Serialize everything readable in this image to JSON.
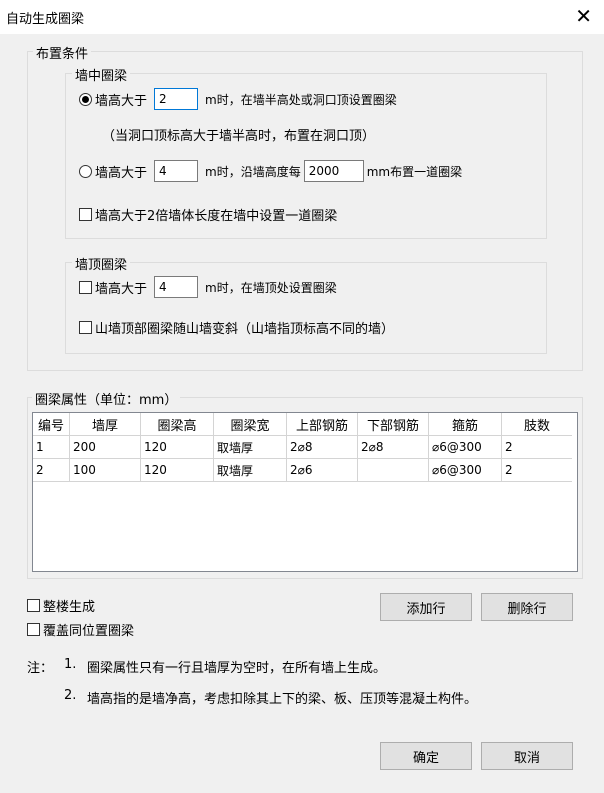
{
  "window": {
    "title": "自动生成圈梁",
    "close_glyph": "✕"
  },
  "layout_group": {
    "label": "布置条件",
    "wall_middle": {
      "label": "墙中圈梁",
      "option1": {
        "prefix": "墙高大于",
        "value": "2",
        "suffix": "m时，在墙半高处或洞口顶设置圈梁",
        "note": "（当洞口顶标高大于墙半高时，布置在洞口顶）",
        "selected": true
      },
      "option2": {
        "prefix": "墙高大于",
        "value": "4",
        "mid": "m时，沿墙高度每",
        "value2": "2000",
        "suffix": "mm布置一道圈梁",
        "selected": false
      },
      "check1": {
        "label": "墙高大于2倍墙体长度在墙中设置一道圈梁",
        "checked": false
      }
    },
    "wall_top": {
      "label": "墙顶圈梁",
      "check1": {
        "prefix": "墙高大于",
        "value": "4",
        "suffix": "m时，在墙顶处设置圈梁",
        "checked": false
      },
      "check2": {
        "label": "山墙顶部圈梁随山墙变斜（山墙指顶标高不同的墙）",
        "checked": false
      }
    }
  },
  "props_group": {
    "label": "圈梁属性（单位：mm）",
    "columns": [
      "编号",
      "墙厚",
      "圈梁高",
      "圈梁宽",
      "上部钢筋",
      "下部钢筋",
      "箍筋",
      "肢数"
    ],
    "rows": [
      [
        "1",
        "200",
        "120",
        "取墙厚",
        "2⌀8",
        "2⌀8",
        "⌀6@300",
        "2"
      ],
      [
        "2",
        "100",
        "120",
        "取墙厚",
        "2⌀6",
        "",
        "⌀6@300",
        "2"
      ]
    ]
  },
  "options": {
    "whole_building": "整楼生成",
    "overwrite": "覆盖同位置圈梁"
  },
  "buttons": {
    "add_row": "添加行",
    "delete_row": "删除行",
    "ok": "确定",
    "cancel": "取消"
  },
  "notes": {
    "prefix": "注：",
    "n1_num": "1.",
    "n1": "圈梁属性只有一行且墙厚为空时，在所有墙上生成。",
    "n2_num": "2.",
    "n2": "墙高指的是墙净高，考虑扣除其上下的梁、板、压顶等混凝土构件。"
  }
}
